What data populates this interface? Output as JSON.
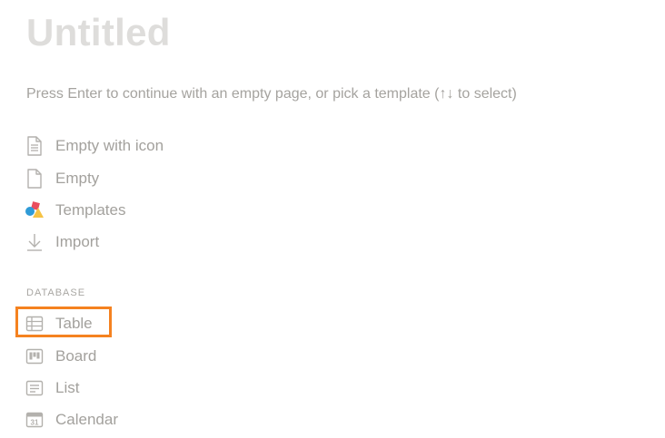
{
  "page": {
    "title": "Untitled",
    "hint": "Press Enter to continue with an empty page, or pick a template (↑↓ to select)"
  },
  "basic_items": [
    {
      "label": "Empty with icon",
      "icon": "page-with-icon-icon"
    },
    {
      "label": "Empty",
      "icon": "empty-page-icon"
    },
    {
      "label": "Templates",
      "icon": "templates-icon"
    },
    {
      "label": "Import",
      "icon": "import-arrow-icon"
    }
  ],
  "database": {
    "header": "DATABASE",
    "items": [
      {
        "label": "Table",
        "icon": "table-icon"
      },
      {
        "label": "Board",
        "icon": "board-icon"
      },
      {
        "label": "List",
        "icon": "list-icon"
      },
      {
        "label": "Calendar",
        "icon": "calendar-icon"
      }
    ],
    "calendar_day": "31"
  },
  "colors": {
    "text": "#a3a19d",
    "title": "#dedddb",
    "highlight": "#f58220",
    "templates_red": "#ea4e5e",
    "templates_blue": "#2f9bd7",
    "templates_yellow": "#f6c344"
  }
}
